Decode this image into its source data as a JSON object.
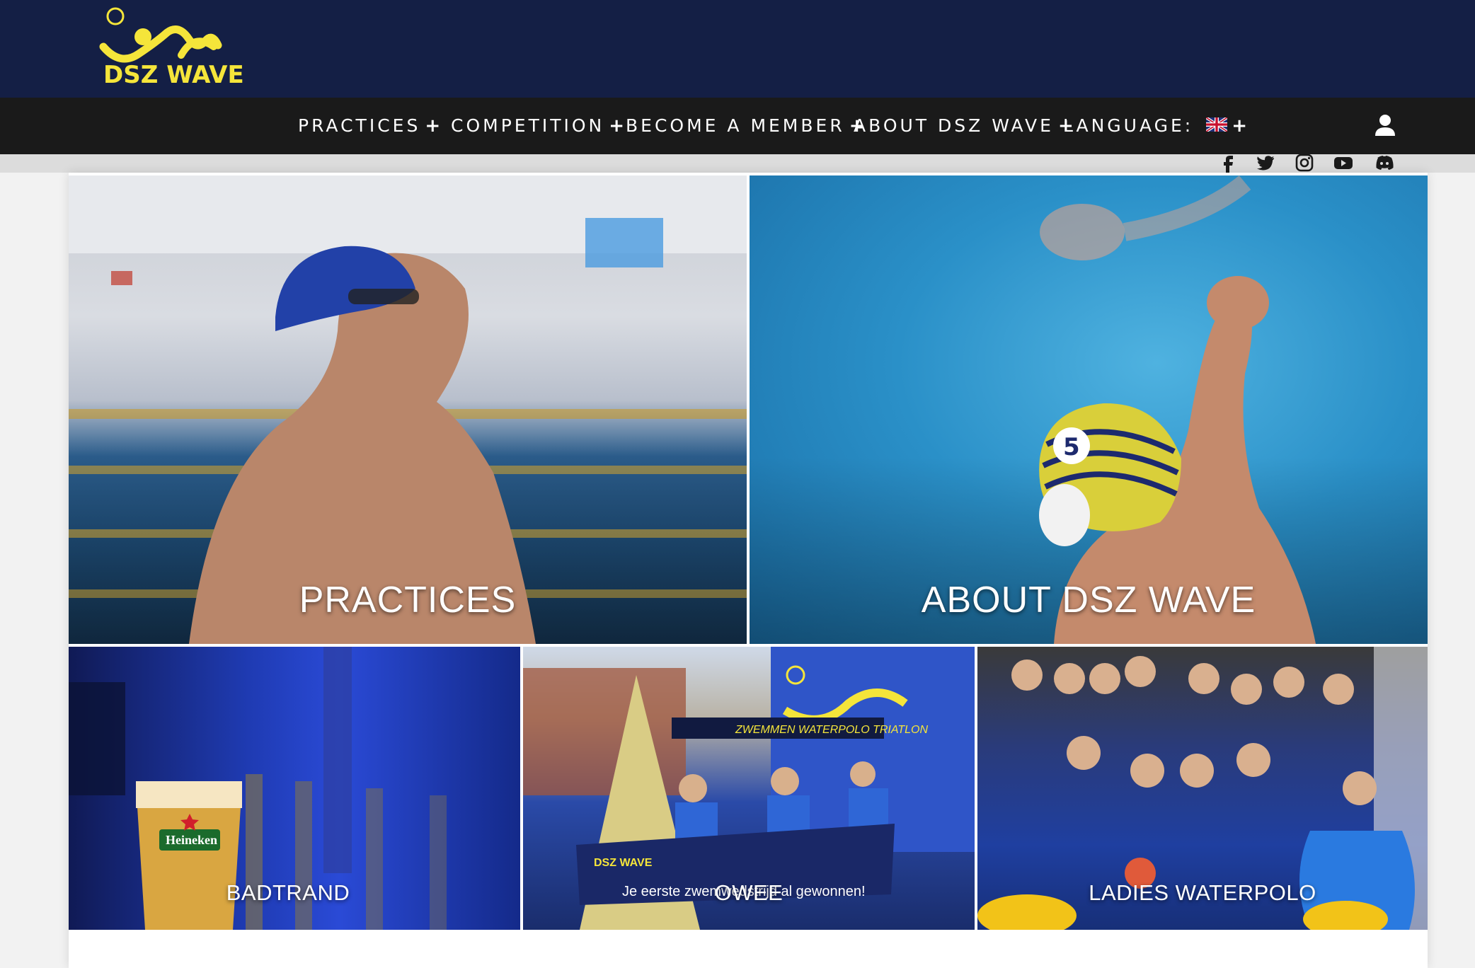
{
  "header": {
    "logo_text": "DSZ WAVE",
    "brand_color": "#141f45",
    "accent_color": "#f5e53a"
  },
  "nav": {
    "items": [
      {
        "label": "PRACTICES",
        "icon": "plus-icon"
      },
      {
        "label": "COMPETITION",
        "icon": "plus-icon"
      },
      {
        "label": "BECOME A MEMBER",
        "icon": "plus-icon"
      },
      {
        "label": "ABOUT DSZ WAVE",
        "icon": "plus-icon"
      },
      {
        "label": "LANGUAGE:",
        "icon": "uk-flag-icon"
      }
    ],
    "user_icon": "user-icon"
  },
  "social": [
    "facebook-icon",
    "twitter-icon",
    "instagram-icon",
    "youtube-icon",
    "discord-icon"
  ],
  "tiles": {
    "practices": "PRACTICES",
    "about": "ABOUT DSZ WAVE",
    "badtrand": "BADTRAND",
    "owee": "OWEE",
    "ladies": "LADIES WATERPOLO"
  }
}
